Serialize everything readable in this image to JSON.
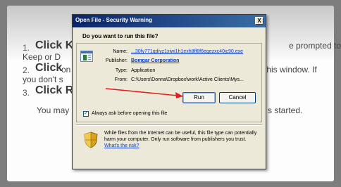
{
  "page": {
    "steps": [
      {
        "num": "1.",
        "bold": "Click Ke",
        "rest": "e prompted to",
        "line2": "Keep or D"
      },
      {
        "num": "2.",
        "bold": "Click",
        "rest_left": "on",
        "rest": "this window. If",
        "line2": "you don't s"
      },
      {
        "num": "3.",
        "bold": "Click Ru"
      }
    ],
    "bottom_left": "You may",
    "bottom_right": "s started."
  },
  "dialog": {
    "title": "Open File - Security Warning",
    "close_label": "X",
    "question": "Do you want to run this file?",
    "fields": [
      {
        "label": "Name:",
        "value": "...30fy771qdiyz1xiwi1h1exh8ff8f6egezxc40jc90.exe",
        "link": true
      },
      {
        "label": "Publisher:",
        "value": "Bomgar Corporation",
        "link": true,
        "bold": true
      },
      {
        "label": "Type:",
        "value": "Application",
        "link": false
      },
      {
        "label": "From:",
        "value": "C:\\Users\\Donna\\Dropbox\\work\\Active Clients\\Mys...",
        "link": false
      }
    ],
    "run_label": "Run",
    "cancel_label": "Cancel",
    "checkbox_label": "Always ask before opening this file",
    "checkbox_checked": true,
    "warning_text": "While files from the Internet can be useful, this file type can potentially harm your computer. Only run software from publishers you trust.",
    "risk_link": "What's the risk?"
  },
  "colors": {
    "title_bar": "#0a246a",
    "link": "#0a3cc8",
    "arrow": "#e02020"
  },
  "icons": [
    "application-icon",
    "shield-icon",
    "checkmark-icon",
    "red-arrow-annotation"
  ]
}
